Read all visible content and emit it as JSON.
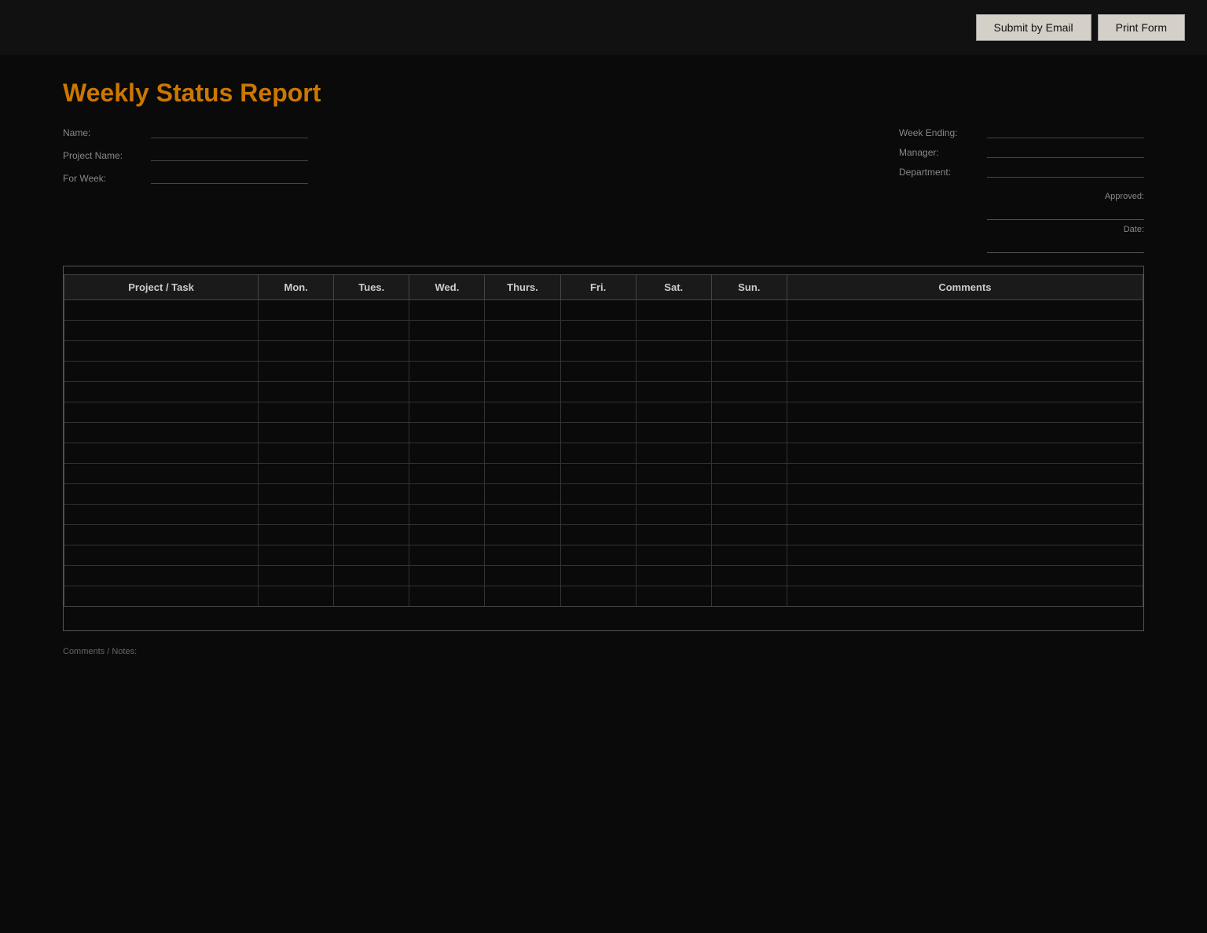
{
  "topbar": {
    "submit_email_label": "Submit by Email",
    "print_form_label": "Print Form"
  },
  "form": {
    "title": "Weekly Status Report",
    "fields": {
      "name_label": "Name:",
      "name_value": "",
      "project_label": "Project Name:",
      "project_value": "",
      "for_week_label": "For Week:",
      "for_week_value": "",
      "right_field1_label": "Week Ending:",
      "right_field1_value": "",
      "right_field2_label": "Manager:",
      "right_field2_value": "",
      "right_field3_label": "Department:",
      "right_field3_value": ""
    },
    "approval": {
      "label1": "Approved:",
      "label2": "Date:"
    },
    "table": {
      "columns": [
        "Project / Task",
        "Mon.",
        "Tues.",
        "Wed.",
        "Thurs.",
        "Fri.",
        "Sat.",
        "Sun.",
        "Comments"
      ],
      "rows": 15
    },
    "footer_label": "Comments / Notes:"
  }
}
